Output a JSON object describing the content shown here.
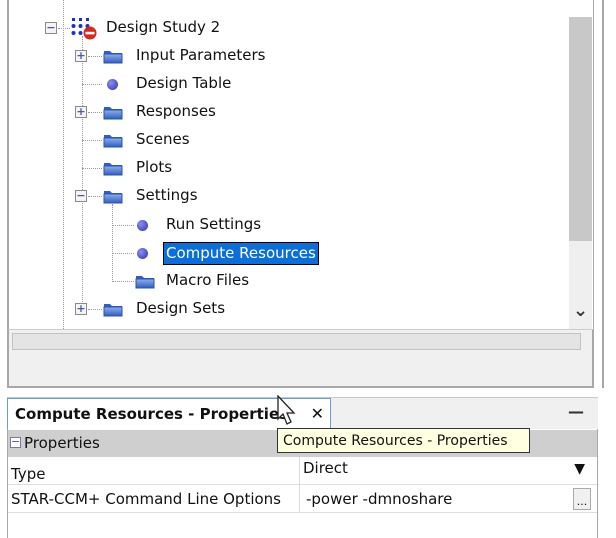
{
  "tree": {
    "root": {
      "label": "Design Study 2",
      "icon": "design-study-icon",
      "expanded": true
    },
    "items": [
      {
        "label": "Input Parameters",
        "icon": "folder-icon",
        "expander": "+"
      },
      {
        "label": "Design Table",
        "icon": "node-dot-icon"
      },
      {
        "label": "Responses",
        "icon": "folder-icon",
        "expander": "+"
      },
      {
        "label": "Scenes",
        "icon": "folder-icon"
      },
      {
        "label": "Plots",
        "icon": "folder-icon"
      },
      {
        "label": "Settings",
        "icon": "folder-icon",
        "expander": "-"
      },
      {
        "label": "Run Settings",
        "icon": "node-dot-icon"
      },
      {
        "label": "Compute Resources",
        "icon": "node-dot-icon",
        "selected": true
      },
      {
        "label": "Macro Files",
        "icon": "folder-icon"
      },
      {
        "label": "Design Sets",
        "icon": "folder-icon",
        "expander": "+"
      }
    ]
  },
  "properties": {
    "tab_title": "Compute Resources - Properties",
    "close": "✕",
    "minimize": "—",
    "section": "Properties",
    "section_toggle": "−",
    "rows": [
      {
        "name": "Type",
        "value": "Direct",
        "control": "▼"
      },
      {
        "name": "STAR-CCM+ Command Line Options",
        "value": "-power -dmnoshare",
        "control": "..."
      }
    ]
  },
  "tooltip": "Compute Resources - Properties",
  "scroll_arrow": "⌄",
  "colors": {
    "selection": "#0a6fd8",
    "folder": "#3d6fd0",
    "tab_border": "#6b9bd6",
    "tooltip_bg": "#ffffe1"
  }
}
